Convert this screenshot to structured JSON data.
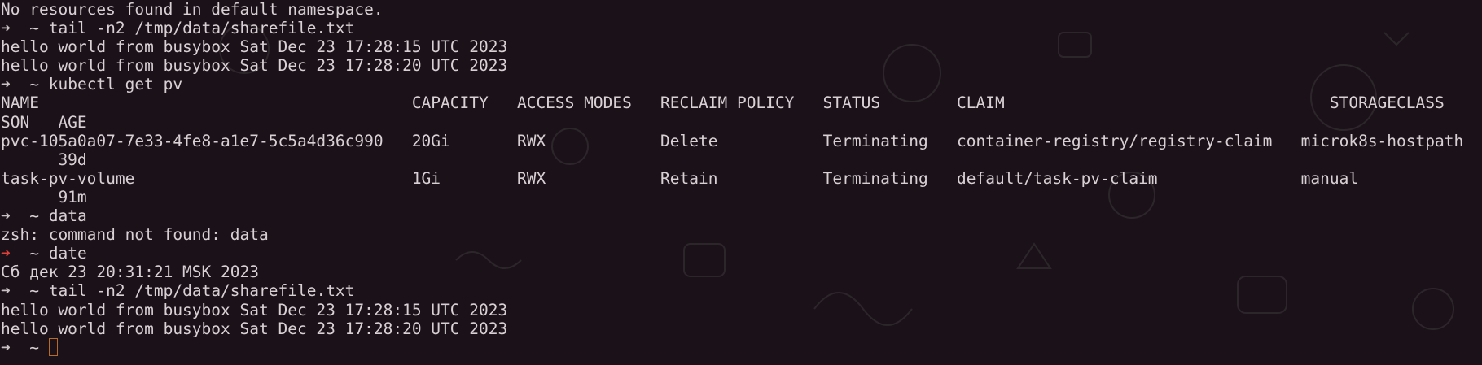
{
  "terminal": {
    "lines": [
      {
        "kind": "output",
        "text": "No resources found in default namespace."
      },
      {
        "kind": "prompt",
        "arrow": "➜",
        "status": "ok",
        "cwd": "~",
        "command": "tail -n2 /tmp/data/sharefile.txt"
      },
      {
        "kind": "output",
        "text": "hello world from busybox Sat Dec 23 17:28:15 UTC 2023"
      },
      {
        "kind": "output",
        "text": "hello world from busybox Sat Dec 23 17:28:20 UTC 2023"
      },
      {
        "kind": "prompt",
        "arrow": "➜",
        "status": "ok",
        "cwd": "~",
        "command": "kubectl get pv"
      },
      {
        "kind": "output",
        "text": "NAME                                       CAPACITY   ACCESS MODES   RECLAIM POLICY   STATUS        CLAIM                                  STORAGECLASS"
      },
      {
        "kind": "output",
        "text": "SON   AGE"
      },
      {
        "kind": "output",
        "text": "pvc-105a0a07-7e33-4fe8-a1e7-5c5a4d36c990   20Gi       RWX            Delete           Terminating   container-registry/registry-claim   microk8s-hostpath"
      },
      {
        "kind": "output",
        "text": "      39d"
      },
      {
        "kind": "output",
        "text": "task-pv-volume                             1Gi        RWX            Retain           Terminating   default/task-pv-claim               manual"
      },
      {
        "kind": "output",
        "text": "      91m"
      },
      {
        "kind": "prompt",
        "arrow": "➜",
        "status": "ok",
        "cwd": "~",
        "command": "data"
      },
      {
        "kind": "output",
        "text": "zsh: command not found: data"
      },
      {
        "kind": "prompt",
        "arrow": "➜",
        "status": "error",
        "cwd": "~",
        "command": "date"
      },
      {
        "kind": "output",
        "text": "Сб дек 23 20:31:21 MSK 2023"
      },
      {
        "kind": "prompt",
        "arrow": "➜",
        "status": "ok",
        "cwd": "~",
        "command": "tail -n2 /tmp/data/sharefile.txt"
      },
      {
        "kind": "output",
        "text": "hello world from busybox Sat Dec 23 17:28:15 UTC 2023"
      },
      {
        "kind": "output",
        "text": "hello world from busybox Sat Dec 23 17:28:20 UTC 2023"
      },
      {
        "kind": "prompt",
        "arrow": "➜",
        "status": "ok",
        "cwd": "~",
        "command": "",
        "cursor": true
      }
    ]
  },
  "colors": {
    "background": "#1a1218",
    "foreground": "#d8d0d4",
    "error_arrow": "#e0403a",
    "cursor": "#b86a2a"
  }
}
